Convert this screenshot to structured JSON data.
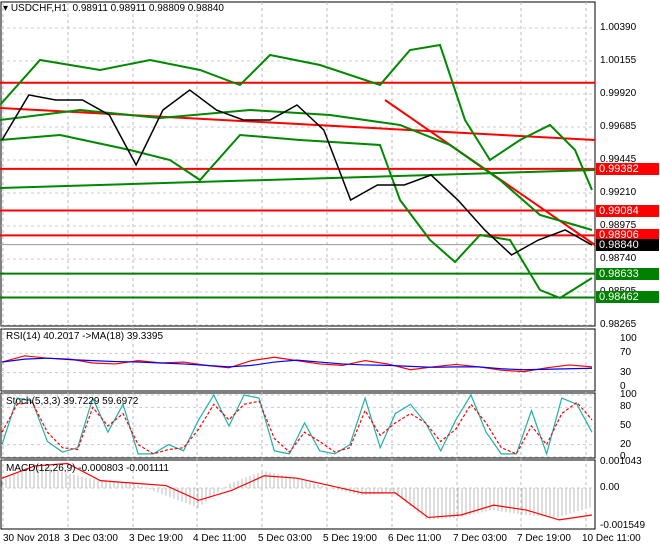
{
  "header": {
    "symbol": "USDCHF,H1",
    "ohlc": "0.98911 0.98911 0.98809 0.98840"
  },
  "indicators": {
    "rsi": "RSI(14) 40.2017  ->MA(18) 39.3395",
    "stoch": "Stoch(5,3,3) 39.7229 59.6972",
    "macd": "MACD(12,26,9) -0.000803 -0.001111"
  },
  "colors": {
    "bear_line": "#ff0000",
    "green": "#008000",
    "price": "#000000"
  },
  "chart_data": {
    "type": "line",
    "title": "USDCHF,H1",
    "ylim": [
      0.98265,
      1.0039
    ],
    "price_ticks": [
      "1.00390",
      "1.00155",
      "0.99920",
      "0.99685",
      "0.99445",
      "0.99210",
      "0.98975",
      "0.98740",
      "0.98505",
      "0.98265"
    ],
    "price_tags": [
      {
        "label": "0.99382",
        "value": 0.99382,
        "color": "#ff0000"
      },
      {
        "label": "0.99084",
        "value": 0.99084,
        "color": "#ff0000"
      },
      {
        "label": "0.98906",
        "value": 0.98906,
        "color": "#ff0000"
      },
      {
        "label": "0.98840",
        "value": 0.9884,
        "color": "#000000"
      },
      {
        "label": "0.98633",
        "value": 0.98633,
        "color": "#008000"
      },
      {
        "label": "0.98462",
        "value": 0.98462,
        "color": "#008000"
      }
    ],
    "resistance_top": 0.99998,
    "x_labels": [
      "30 Nov 2018",
      "3 Dec 03:00",
      "3 Dec 19:00",
      "4 Dec 11:00",
      "5 Dec 03:00",
      "5 Dec 19:00",
      "6 Dec 11:00",
      "7 Dec 03:00",
      "7 Dec 19:00",
      "10 Dec 11:00"
    ],
    "close": [
      0.99589,
      0.99911,
      0.99875,
      0.99875,
      0.99768,
      0.9941,
      0.99803,
      0.99946,
      0.99803,
      0.99732,
      0.99732,
      0.99839,
      0.9966,
      0.99159,
      0.99267,
      0.99267,
      0.99338,
      0.99159,
      0.98945,
      0.98766,
      0.98873,
      0.98945,
      0.98837
    ],
    "rsi_ticks": [
      "100",
      "70",
      "30",
      "0"
    ],
    "rsi": [
      52,
      65,
      60,
      58,
      50,
      48,
      55,
      50,
      52,
      45,
      40,
      55,
      62,
      55,
      48,
      45,
      55,
      48,
      36,
      42,
      47,
      42,
      35,
      32,
      40,
      46,
      42
    ],
    "rsi_ma": [
      52,
      58,
      60,
      57,
      55,
      53,
      52,
      50,
      48,
      45,
      42,
      45,
      52,
      56,
      52,
      48,
      46,
      45,
      43,
      41,
      42,
      42,
      38,
      36,
      37,
      38,
      39
    ],
    "stoch_ticks": [
      "100",
      "80",
      "50",
      "20",
      "0"
    ],
    "stoch_main": [
      20,
      95,
      90,
      25,
      8,
      15,
      95,
      40,
      85,
      5,
      5,
      20,
      10,
      60,
      100,
      50,
      100,
      95,
      10,
      5,
      55,
      10,
      5,
      20,
      95,
      15,
      70,
      85,
      55,
      10,
      60,
      100,
      40,
      5,
      5,
      75,
      5,
      95,
      85,
      40
    ],
    "stoch_signal": [
      40,
      85,
      88,
      40,
      15,
      12,
      80,
      50,
      70,
      20,
      5,
      12,
      15,
      45,
      85,
      60,
      85,
      90,
      30,
      8,
      40,
      25,
      8,
      15,
      75,
      35,
      55,
      70,
      55,
      25,
      45,
      85,
      55,
      15,
      5,
      50,
      20,
      70,
      88,
      60
    ],
    "macd_ticks": [
      "0.001043",
      "0.00",
      "-0.001549"
    ],
    "macd_signal": [
      0.0004,
      0.0009,
      0.001,
      0.0003,
      0.0002,
      0.0001,
      -0.0005,
      -0.0001,
      0.0005,
      0.0004,
      0.0001,
      -0.0002,
      -0.0002,
      -0.0012,
      -0.0011,
      -0.0007,
      -0.0009,
      -0.0013,
      -0.0011
    ],
    "macd_hist": [
      0.0003,
      0.001,
      0.0006,
      0.0003,
      0.0002,
      -0.0003,
      -0.0008,
      0.0002,
      0.0007,
      0.0004,
      0.0,
      -0.0003,
      -0.0002,
      -0.0013,
      -0.0012,
      -0.0009,
      -0.0011,
      -0.0012,
      -0.0008
    ]
  }
}
